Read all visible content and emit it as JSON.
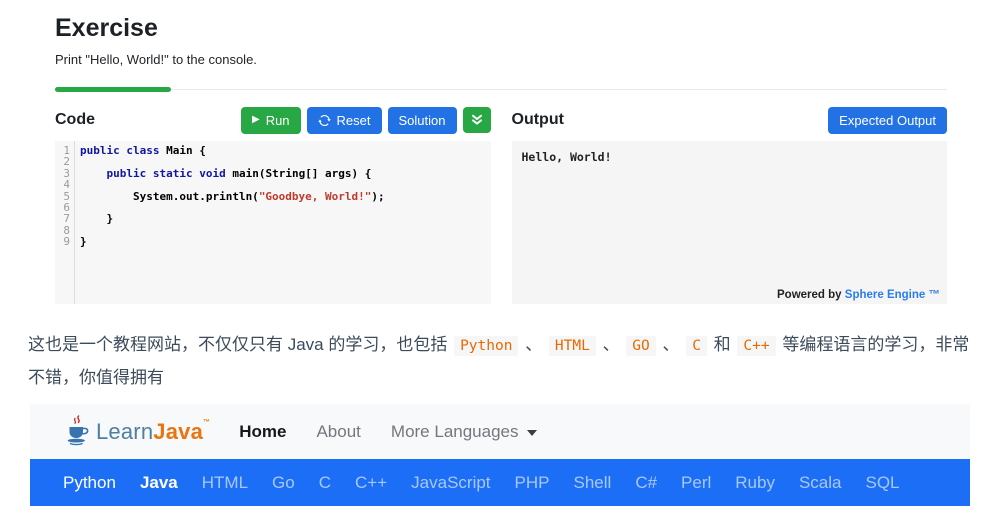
{
  "colors": {
    "accent_green": "#28a745",
    "accent_blue": "#2272e6",
    "langbar_blue": "#1b6ef5",
    "inline_code_orange": "#e96900",
    "logo_blue": "#4d7fa3",
    "logo_orange": "#e87511"
  },
  "icons": {
    "play": "▶",
    "reset": "circular-arrows",
    "collapse": "double-chevron-down",
    "nav_caret": "triangle-down",
    "logo": "java-coffee-cup"
  },
  "exercise": {
    "title": "Exercise",
    "subtitle": "Print \"Hello, World!\" to the console.",
    "code_panel": {
      "title": "Code",
      "run_label": "Run",
      "reset_label": "Reset",
      "solution_label": "Solution",
      "lines": [
        [
          [
            "k",
            "public class"
          ],
          [
            "p",
            " Main {"
          ]
        ],
        [],
        [
          [
            "p",
            "    "
          ],
          [
            "k",
            "public static void"
          ],
          [
            "p",
            " main(String[] args) {"
          ]
        ],
        [],
        [
          [
            "p",
            "        System.out.println("
          ],
          [
            "s",
            "\"Goodbye, World!\""
          ],
          [
            "p",
            ");"
          ]
        ],
        [],
        [
          [
            "p",
            "    }"
          ]
        ],
        [],
        [
          [
            "p",
            "}"
          ]
        ]
      ]
    },
    "output_panel": {
      "title": "Output",
      "expected_label": "Expected Output",
      "text": "Hello, World!",
      "powered_prefix": "Powered by",
      "powered_link": "Sphere Engine ™"
    }
  },
  "note": {
    "segments": [
      {
        "t": "这也是一个教程网站，不仅仅只有 Java 的学习，也包括 ",
        "code": false
      },
      {
        "t": "Python",
        "code": true
      },
      {
        "t": " 、 ",
        "code": false
      },
      {
        "t": "HTML",
        "code": true
      },
      {
        "t": " 、 ",
        "code": false
      },
      {
        "t": "GO",
        "code": true
      },
      {
        "t": " 、 ",
        "code": false
      },
      {
        "t": "C",
        "code": true
      },
      {
        "t": " 和 ",
        "code": false
      },
      {
        "t": "C++",
        "code": true
      },
      {
        "t": " 等编程语言的学习，非常不错，你值得拥有",
        "code": false
      }
    ]
  },
  "site": {
    "logo": {
      "learn": "Learn",
      "java": "Java",
      "tm": "™"
    },
    "nav_items": [
      {
        "label": "Home",
        "active": true
      },
      {
        "label": "About"
      },
      {
        "label": "More Languages",
        "caret": true
      }
    ],
    "lang_items": [
      {
        "label": "Python",
        "bright": true
      },
      {
        "label": "Java",
        "active": true
      },
      {
        "label": "HTML"
      },
      {
        "label": "Go"
      },
      {
        "label": "C"
      },
      {
        "label": "C++"
      },
      {
        "label": "JavaScript"
      },
      {
        "label": "PHP"
      },
      {
        "label": "Shell"
      },
      {
        "label": "C#"
      },
      {
        "label": "Perl"
      },
      {
        "label": "Ruby"
      },
      {
        "label": "Scala"
      },
      {
        "label": "SQL"
      }
    ]
  }
}
